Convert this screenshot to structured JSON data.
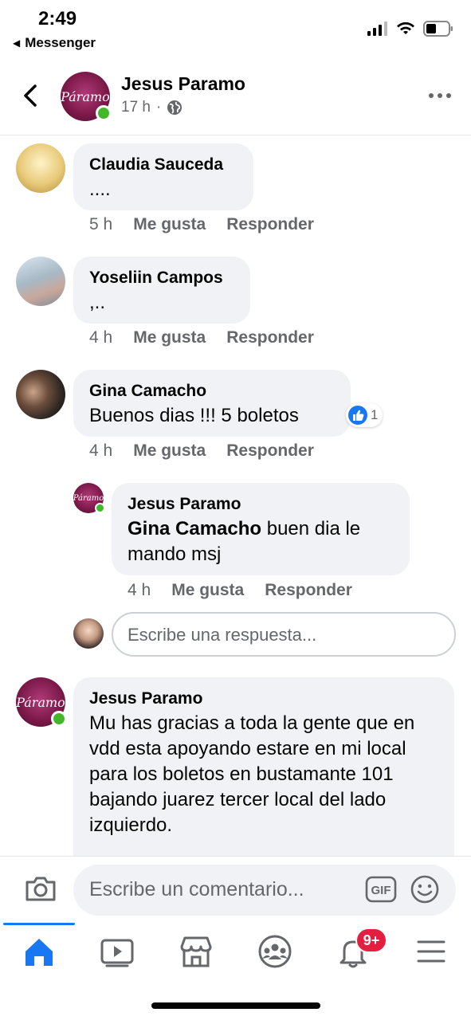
{
  "status_bar": {
    "time": "2:49",
    "back_app": "Messenger"
  },
  "post_header": {
    "author": "Jesus Paramo",
    "timestamp": "17 h",
    "separator": "·",
    "audience_icon": "globe-icon",
    "avatar_text": "Páramo"
  },
  "comments": [
    {
      "name": "Claudia Sauceda",
      "text": "....",
      "time": "5 h",
      "like": "Me gusta",
      "reply": "Responder"
    },
    {
      "name": "Yoseliin Campos",
      "text": ",..",
      "time": "4 h",
      "like": "Me gusta",
      "reply": "Responder"
    },
    {
      "name": "Gina Camacho",
      "text": "Buenos dias !!! 5 boletos",
      "time": "4 h",
      "like": "Me gusta",
      "reply": "Responder",
      "reaction_count": "1",
      "reaction_icon": "thumbs-up-icon"
    },
    {
      "name": "Jesus Paramo",
      "mention": "Gina Camacho",
      "text": "buen dia le mando msj",
      "time": "4 h",
      "like": "Me gusta",
      "reply": "Responder",
      "avatar_text": "Páramo"
    },
    {
      "name": "Jesus Paramo",
      "text": "Mu has gracias a toda la gente que en vdd esta apoyando estare en mi local para los boletos en bustamante 101 bajando juarez tercer local del lado izquierdo.",
      "avatar_text": "Páramo"
    }
  ],
  "reply_input": {
    "placeholder": "Escribe una respuesta..."
  },
  "composer": {
    "placeholder": "Escribe un comentario...",
    "gif_label": "GIF"
  },
  "tab_bar": {
    "items": [
      "home-icon",
      "video-icon",
      "marketplace-icon",
      "groups-icon",
      "notifications-icon",
      "menu-icon"
    ],
    "notification_badge": "9+"
  },
  "colors": {
    "accent": "#1877f2",
    "online": "#42b72a",
    "badge": "#e41e3f",
    "bubble": "#f0f2f5",
    "meta": "#65676b"
  }
}
